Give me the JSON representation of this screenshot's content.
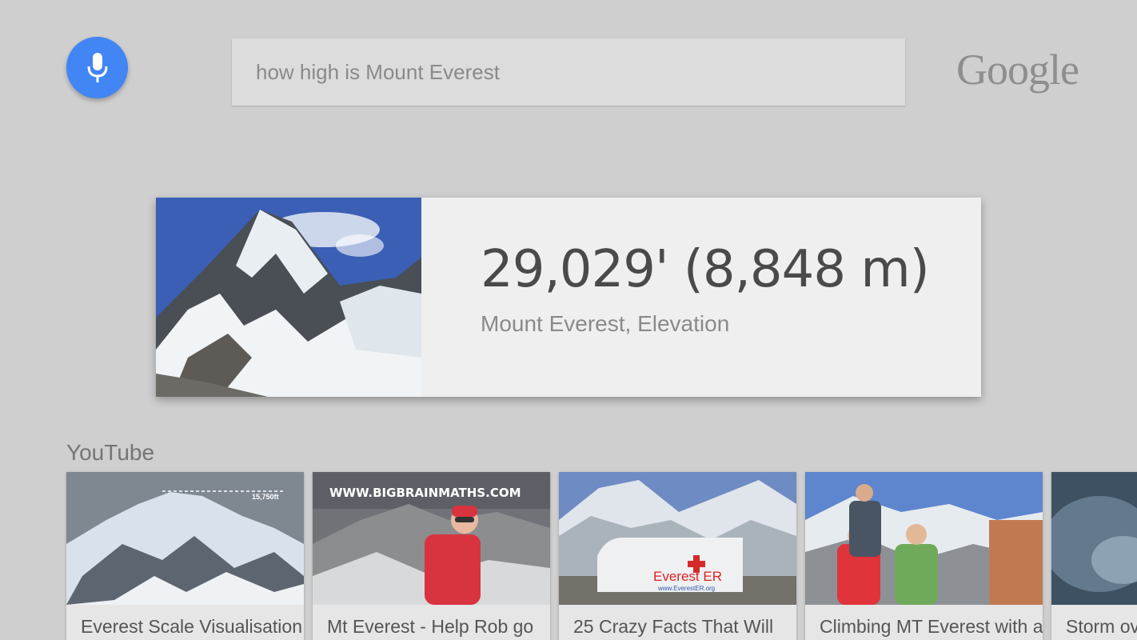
{
  "search": {
    "query": "how high is Mount Everest"
  },
  "brand": {
    "logo_text": "Google"
  },
  "answer": {
    "value": "29,029' (8,848 m)",
    "label": "Mount Everest, Elevation"
  },
  "youtube": {
    "section_title": "YouTube",
    "videos": [
      {
        "title": "Everest Scale Visualisation",
        "thumb_height_mark": "15,750ft"
      },
      {
        "title": "Mt Everest - Help Rob go",
        "thumb_caption": "WWW.BIGBRAINMATHS.COM"
      },
      {
        "title": "25 Crazy Facts That Will",
        "thumb_label": "Everest ER",
        "thumb_url": "www.EverestER.org"
      },
      {
        "title": "Climbing MT Everest with a"
      },
      {
        "title": "Storm ove"
      }
    ]
  },
  "colors": {
    "background": "#cfcfcf",
    "mic_button": "#4285f4",
    "card": "#efefef"
  },
  "icons": {
    "mic": "microphone-icon"
  }
}
